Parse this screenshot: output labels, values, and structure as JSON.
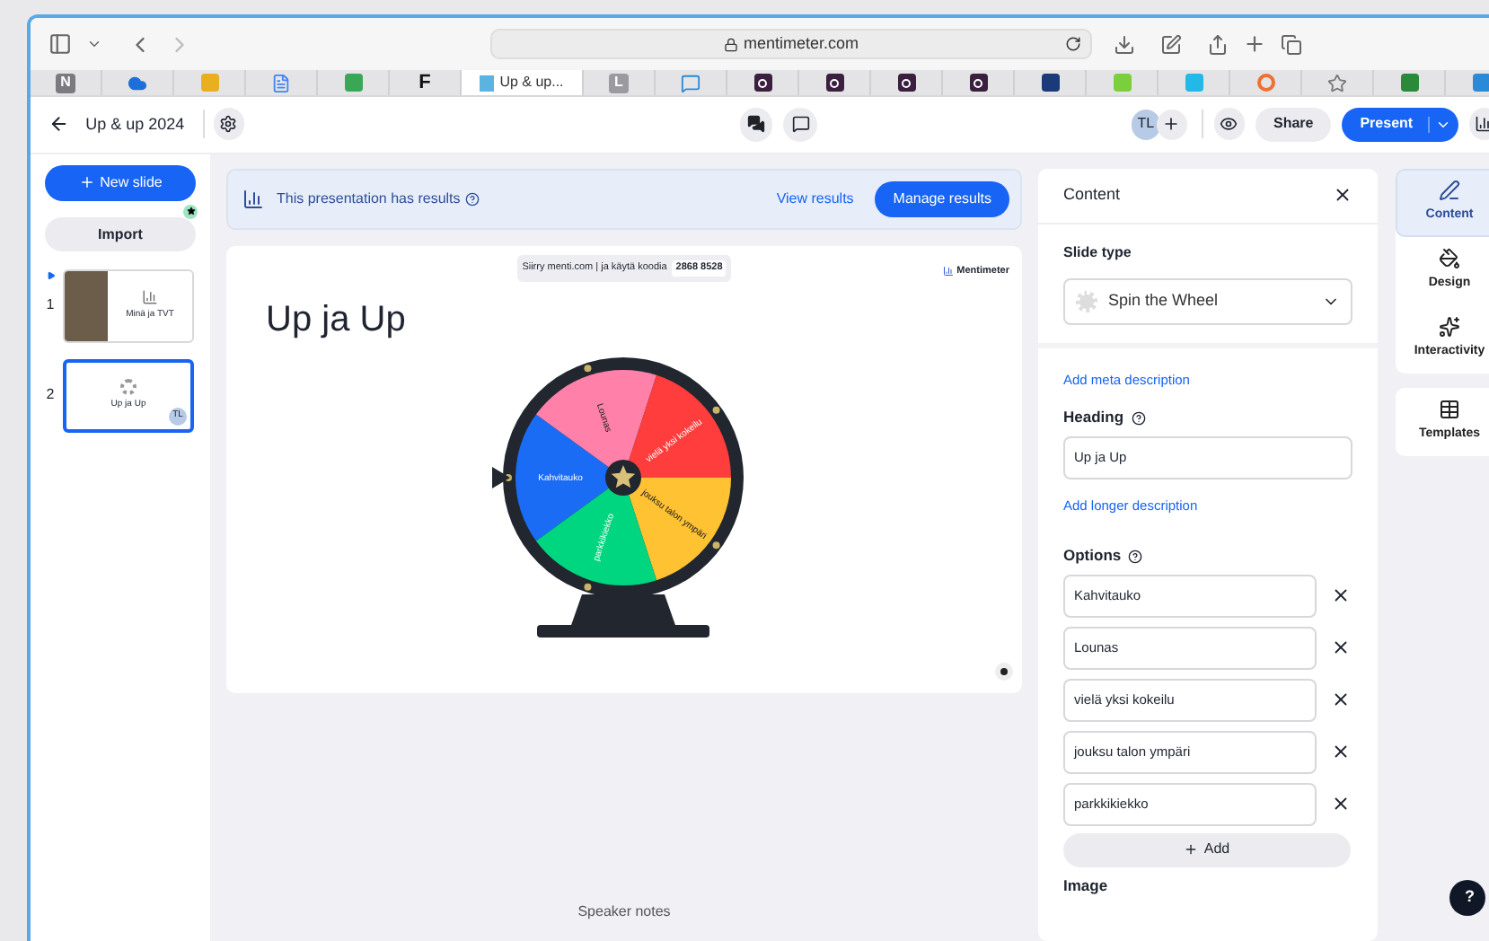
{
  "browser": {
    "url": "mentimeter.com",
    "tabs": [
      {
        "glyph": "N",
        "kind": "letter",
        "color": "#7a7a80",
        "selected": false
      },
      {
        "kind": "cloud",
        "color": "#1e6fd9",
        "selected": false
      },
      {
        "kind": "square",
        "color": "#e8b020",
        "selected": false
      },
      {
        "kind": "doc",
        "color": "#4285f4",
        "selected": false
      },
      {
        "kind": "square",
        "color": "#3aa757",
        "selected": false
      },
      {
        "glyph": "F",
        "kind": "letter-plain",
        "color": "#111111",
        "selected": false
      },
      {
        "label": "Up & up...",
        "kind": "page",
        "color": "#5bb3e0",
        "selected": true
      },
      {
        "glyph": "L",
        "kind": "letter",
        "color": "#9a9aa0",
        "selected": false
      },
      {
        "kind": "chat",
        "color": "#2a8ad8",
        "selected": false
      },
      {
        "kind": "q",
        "color": "#3a1f3f",
        "selected": false
      },
      {
        "kind": "q",
        "color": "#3a1f3f",
        "selected": false
      },
      {
        "kind": "q",
        "color": "#3a1f3f",
        "selected": false
      },
      {
        "kind": "q",
        "color": "#3a1f3f",
        "selected": false
      },
      {
        "kind": "square",
        "color": "#1b3a7a",
        "selected": false
      },
      {
        "kind": "square",
        "color": "#7ad03a",
        "selected": false
      },
      {
        "kind": "square",
        "color": "#22b8e8",
        "selected": false
      },
      {
        "kind": "circle",
        "color": "#f07030",
        "selected": false
      },
      {
        "kind": "star",
        "color": "#777777",
        "selected": false
      },
      {
        "kind": "square",
        "color": "#2a8a3a",
        "selected": false
      },
      {
        "kind": "square",
        "color": "#2a8ad8",
        "selected": false
      }
    ]
  },
  "header": {
    "title": "Up & up 2024",
    "avatar": "TL",
    "share": "Share",
    "present": "Present"
  },
  "sidebar": {
    "new_slide": "New slide",
    "import": "Import",
    "import_badge": true,
    "slides": [
      {
        "number": "1",
        "title": "Minä ja TVT",
        "kind": "photo",
        "selected": false,
        "current": true
      },
      {
        "number": "2",
        "title": "Up ja Up",
        "kind": "wheel",
        "avatar": "TL",
        "selected": true,
        "current": false
      }
    ]
  },
  "results_banner": {
    "text": "This presentation has results",
    "view": "View results",
    "manage": "Manage results"
  },
  "slide": {
    "join_text": "Siirry menti.com | ja käytä koodia",
    "code": "2868 8528",
    "brand": "Mentimeter",
    "heading": "Up ja Up",
    "wheel": [
      {
        "label": "Kahvitauko",
        "color": "#1b6cf5"
      },
      {
        "label": "Lounas",
        "color": "#ff80a8"
      },
      {
        "label": "vielä yksi kokeilu",
        "color": "#ff3d3d"
      },
      {
        "label": "jouksu talon ympäri",
        "color": "#ffc233"
      },
      {
        "label": "parkkikiekko",
        "color": "#00d67f"
      }
    ]
  },
  "speaker_notes": "Speaker notes",
  "panel": {
    "title": "Content",
    "slide_type_label": "Slide type",
    "slide_type": "Spin the Wheel",
    "meta_link": "Add meta description",
    "heading_label": "Heading",
    "heading_value": "Up ja Up",
    "longer_link": "Add longer description",
    "options_label": "Options",
    "options": [
      "Kahvitauko",
      "Lounas",
      "vielä yksi kokeilu",
      "jouksu talon ympäri",
      "parkkikiekko"
    ],
    "add": "Add",
    "image_label": "Image"
  },
  "side_tabs": [
    {
      "label": "Content",
      "kind": "pen",
      "selected": true
    },
    {
      "label": "Design",
      "kind": "brush",
      "selected": false
    },
    {
      "label": "Interactivity",
      "kind": "spark",
      "selected": false
    },
    {
      "label": "Templates",
      "kind": "table",
      "selected": false
    }
  ],
  "help": "?"
}
